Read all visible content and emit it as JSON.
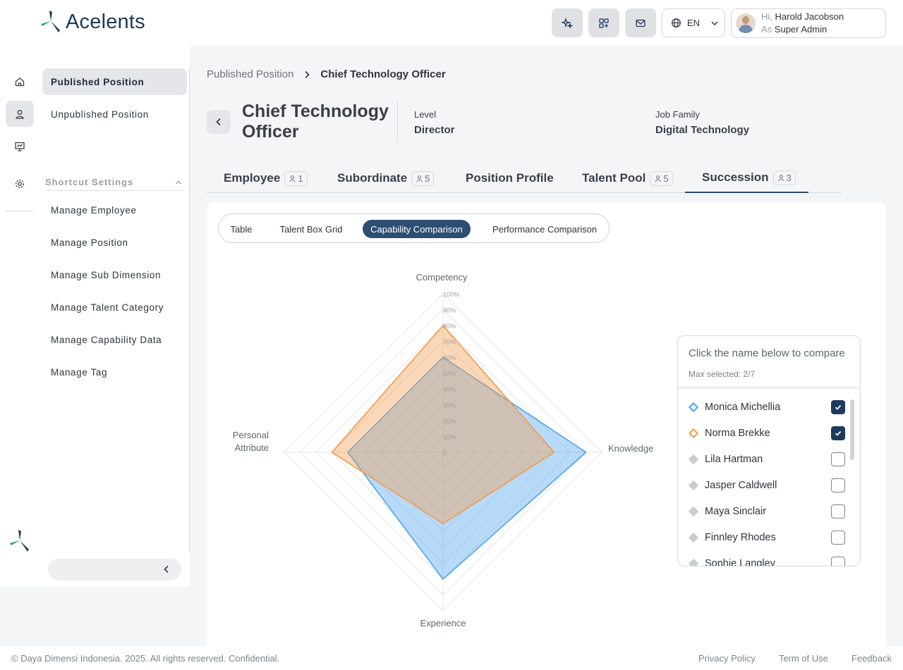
{
  "app": {
    "name": "Acelents"
  },
  "header": {
    "language": "EN",
    "greeting_prefix": "Hi,",
    "user_name": "Harold Jacobson",
    "role_prefix": "As",
    "role": "Super Admin"
  },
  "sidebar": {
    "items": [
      {
        "label": "Published Position",
        "active": true
      },
      {
        "label": "Unpublished Position",
        "active": false
      }
    ],
    "shortcut_title": "Shortcut Settings",
    "shortcuts": [
      "Manage Employee",
      "Manage Position",
      "Manage Sub Dimension",
      "Manage Talent Category",
      "Manage Capability Data",
      "Manage Tag"
    ]
  },
  "breadcrumb": {
    "parent": "Published Position",
    "current": "Chief Technology Officer"
  },
  "position": {
    "title": "Chief Technology Officer",
    "level_label": "Level",
    "level_value": "Director",
    "family_label": "Job Family",
    "family_value": "Digital Technology"
  },
  "tabs": [
    {
      "label": "Employee",
      "count": "1"
    },
    {
      "label": "Subordinate",
      "count": "5"
    },
    {
      "label": "Position Profile",
      "count": ""
    },
    {
      "label": "Talent Pool",
      "count": "5"
    },
    {
      "label": "Succession",
      "count": "3",
      "active": true
    }
  ],
  "view_toggle": {
    "options": [
      "Table",
      "Talent Box Grid",
      "Capability Comparison",
      "Performance Comparison"
    ],
    "selected": "Capability Comparison"
  },
  "chart_data": {
    "type": "radar",
    "axes": [
      "Competency",
      "Knowledge",
      "Experience",
      "Personal Attribute"
    ],
    "ticks": [
      "0",
      "10%",
      "20%",
      "30%",
      "40%",
      "50%",
      "60%",
      "70%",
      "80%",
      "90%",
      "100%"
    ],
    "range": [
      0,
      100
    ],
    "series": [
      {
        "name": "Monica Michellia",
        "values": [
          60,
          90,
          80,
          60
        ],
        "color": "#4da3f0"
      },
      {
        "name": "Norma Brekke",
        "values": [
          80,
          70,
          45,
          70
        ],
        "color": "#f29a4a"
      }
    ]
  },
  "compare_panel": {
    "title": "Click the name below to compare",
    "subtitle": "Max selected: 2/7",
    "people": [
      {
        "name": "Monica Michellia",
        "checked": true,
        "color": "#4da3f0"
      },
      {
        "name": "Norma Brekke",
        "checked": true,
        "color": "#f29a4a"
      },
      {
        "name": "Lila Hartman",
        "checked": false,
        "color": "#c9ccd1"
      },
      {
        "name": "Jasper Caldwell",
        "checked": false,
        "color": "#c9ccd1"
      },
      {
        "name": "Maya Sinclair",
        "checked": false,
        "color": "#c9ccd1"
      },
      {
        "name": "Finnley Rhodes",
        "checked": false,
        "color": "#c9ccd1"
      },
      {
        "name": "Sophie Langley",
        "checked": false,
        "color": "#c9ccd1"
      }
    ]
  },
  "footer": {
    "copyright": "© Daya Dimensi Indonesia. 2025. All rights reserved. Confidential.",
    "links": [
      "Privacy Policy",
      "Term of Use",
      "Feedback"
    ]
  }
}
